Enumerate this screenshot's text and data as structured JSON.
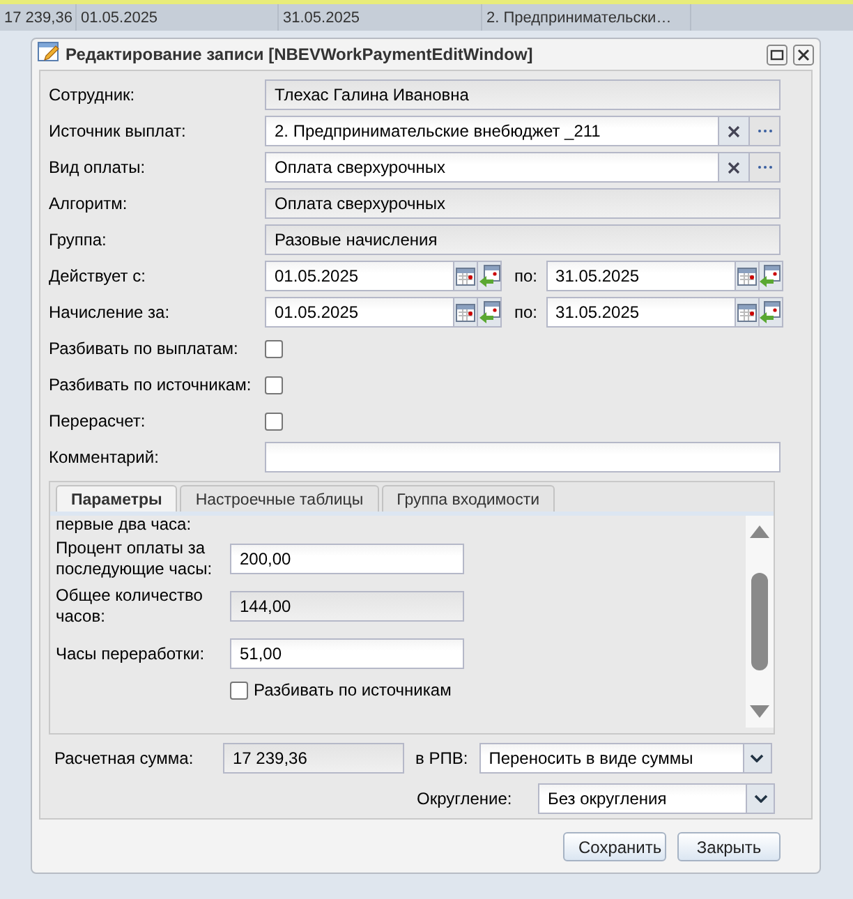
{
  "background_grid": {
    "cells": [
      "17 239,36",
      "01.05.2025",
      "31.05.2025",
      "2. Предпринимательски…"
    ]
  },
  "window": {
    "title": "Редактирование записи [NBEVWorkPaymentEditWindow]"
  },
  "form": {
    "rows": [
      {
        "kind": "text",
        "label": "Сотрудник:",
        "value": "Тлехас Галина Ивановна",
        "readonly": true
      },
      {
        "kind": "lookup",
        "label": "Источник выплат:",
        "value": "2. Предпринимательские внебюджет _211",
        "readonly": false
      },
      {
        "kind": "lookup",
        "label": "Вид оплаты:",
        "value": "Оплата сверхурочных",
        "readonly": false
      },
      {
        "kind": "text",
        "label": "Алгоритм:",
        "value": "Оплата сверхурочных",
        "readonly": true
      },
      {
        "kind": "text",
        "label": "Группа:",
        "value": "Разовые начисления",
        "readonly": true
      },
      {
        "kind": "daterange",
        "label": "Действует с:",
        "from": "01.05.2025",
        "to_label": "по:",
        "to": "31.05.2025"
      },
      {
        "kind": "daterange",
        "label": "Начисление за:",
        "from": "01.05.2025",
        "to_label": "по:",
        "to": "31.05.2025"
      },
      {
        "kind": "checkbox",
        "label": "Разбивать по выплатам:",
        "checked": false
      },
      {
        "kind": "checkbox",
        "label": "Разбивать по источникам:",
        "checked": false
      },
      {
        "kind": "checkbox",
        "label": "Перерасчет:",
        "checked": false
      },
      {
        "kind": "text",
        "label": "Комментарий:",
        "value": "",
        "readonly": false
      }
    ]
  },
  "tabs": [
    {
      "label": "Параметры",
      "selected": true
    },
    {
      "label": "Настроечные таблицы",
      "selected": false
    },
    {
      "label": "Группа входимости",
      "selected": false
    }
  ],
  "params": {
    "rows": [
      {
        "kind": "cut",
        "label": "первые два часа:"
      },
      {
        "kind": "field",
        "label": "Процент оплаты за последующие часы:",
        "value": "200,00",
        "readonly": false
      },
      {
        "kind": "field",
        "label": "Общее количество часов:",
        "value": "144,00",
        "readonly": true
      },
      {
        "kind": "field",
        "label": "Часы переработки:",
        "value": "51,00",
        "readonly": false
      },
      {
        "kind": "checkbox",
        "label": "Разбивать по источникам",
        "checked": false
      }
    ]
  },
  "footer": {
    "sum_label": "Расчетная сумма:",
    "sum_value": "17 239,36",
    "rpv_label": "в РПВ:",
    "rpv_value": "Переносить в виде суммы",
    "rounding_label": "Округление:",
    "rounding_value": "Без округления"
  },
  "buttons": [
    "Сохранить",
    "Закрыть"
  ]
}
